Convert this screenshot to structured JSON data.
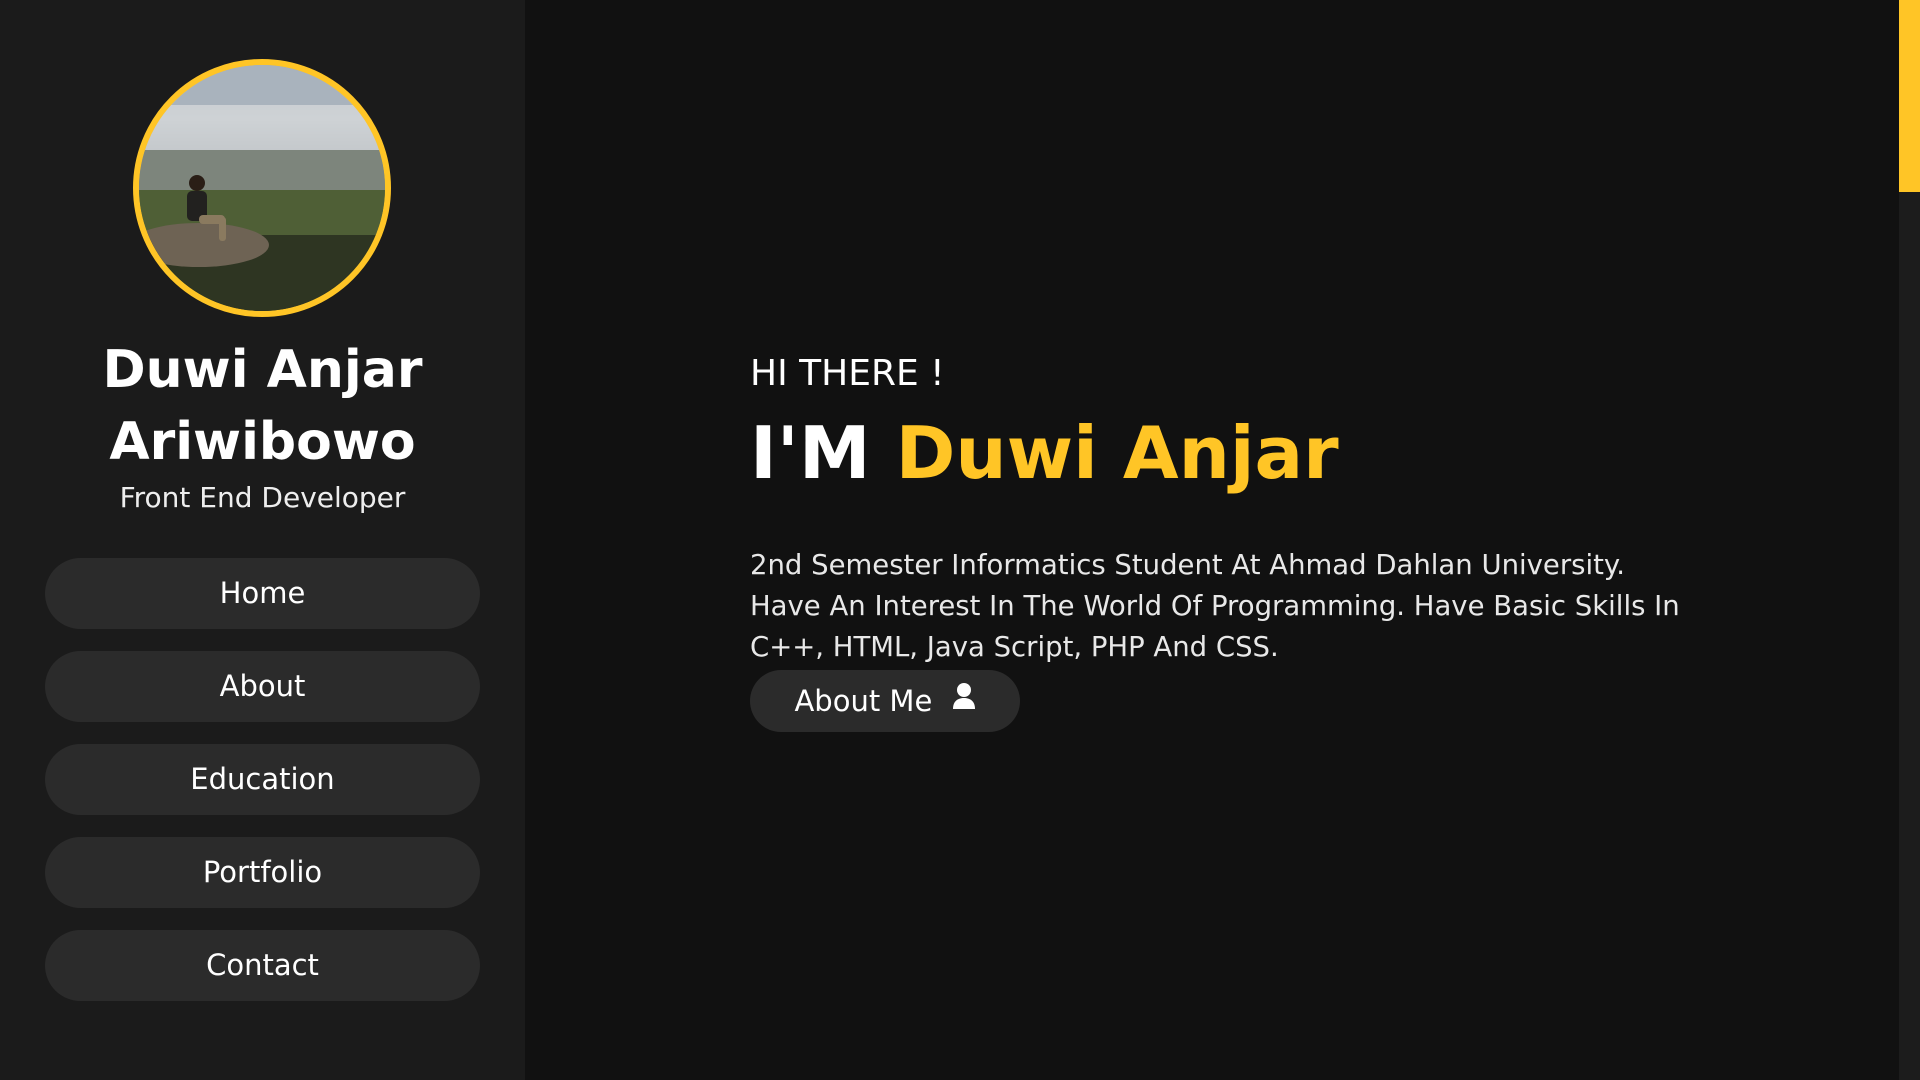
{
  "sidebar": {
    "name": "Duwi Anjar Ariwibowo",
    "role": "Front End Developer",
    "nav": [
      {
        "label": "Home"
      },
      {
        "label": "About"
      },
      {
        "label": "Education"
      },
      {
        "label": "Portfolio"
      },
      {
        "label": "Contact"
      }
    ]
  },
  "hero": {
    "greeting": "HI THERE !",
    "headline_prefix": "I'M",
    "headline_name": "Duwi Anjar",
    "intro": "2nd Semester Informatics Student At Ahmad Dahlan University. Have An Interest In The World Of Programming. Have Basic Skills In C++, HTML, Java Script, PHP And CSS.",
    "about_button_label": "About Me",
    "about_button_icon": "user-icon"
  },
  "colors": {
    "accent": "#ffc526",
    "sidebar_bg": "#1b1b1b",
    "main_bg": "#111111",
    "button_bg": "#2b2b2b"
  }
}
